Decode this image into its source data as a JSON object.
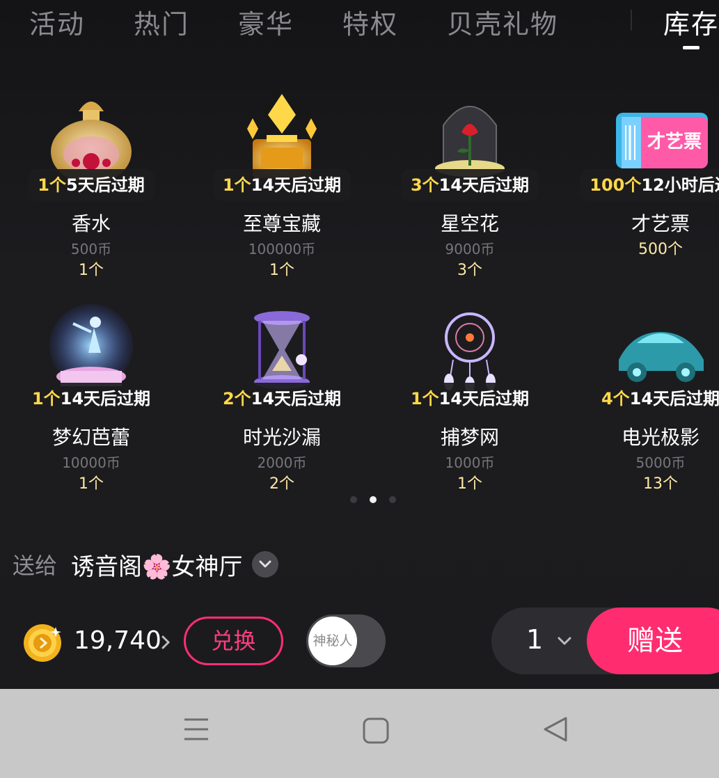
{
  "tabs": [
    {
      "label": "活动"
    },
    {
      "label": "热门"
    },
    {
      "label": "豪华"
    },
    {
      "label": "特权"
    },
    {
      "label": "贝壳礼物"
    },
    {
      "label": "库存",
      "active": true
    }
  ],
  "gifts": [
    {
      "name": "香水",
      "badge_count": "1个",
      "badge_expire": "5天后过期",
      "price": "500币",
      "count": "1个",
      "icon": "perfume-bottle-icon"
    },
    {
      "name": "至尊宝藏",
      "badge_count": "1个",
      "badge_expire": "14天后过期",
      "price": "100000币",
      "count": "1个",
      "icon": "treasure-icon"
    },
    {
      "name": "星空花",
      "badge_count": "3个",
      "badge_expire": "14天后过期",
      "price": "9000币",
      "count": "3个",
      "icon": "rose-dome-icon"
    },
    {
      "name": "才艺票",
      "badge_count": "100个",
      "badge_expire": "12小时后过",
      "price": "",
      "count": "500个",
      "icon": "talent-ticket-icon",
      "ticket_text": "才艺票"
    },
    {
      "name": "梦幻芭蕾",
      "badge_count": "1个",
      "badge_expire": "14天后过期",
      "price": "10000币",
      "count": "1个",
      "icon": "ballet-music-box-icon"
    },
    {
      "name": "时光沙漏",
      "badge_count": "2个",
      "badge_expire": "14天后过期",
      "price": "2000币",
      "count": "2个",
      "icon": "hourglass-icon"
    },
    {
      "name": "捕梦网",
      "badge_count": "1个",
      "badge_expire": "14天后过期",
      "price": "1000币",
      "count": "1个",
      "icon": "dreamcatcher-icon"
    },
    {
      "name": "电光极影",
      "badge_count": "4个",
      "badge_expire": "14天后过期",
      "price": "5000币",
      "count": "13个",
      "icon": "electric-car-icon"
    }
  ],
  "pager": {
    "pages": 3,
    "current": 2
  },
  "send_to": {
    "label": "送给",
    "recipient": "诱音阁🌸女神厅"
  },
  "wallet": {
    "balance": "19,740",
    "exchange_label": "兑换"
  },
  "anonymous": {
    "label": "神秘人",
    "enabled": false
  },
  "quantity": {
    "value": "1"
  },
  "give_button": {
    "label": "赠送"
  },
  "colors": {
    "accent": "#ff2d6f",
    "badge_number": "#ffd84a",
    "count": "#ffe9a6",
    "panel_bg": "#1b1b1e",
    "navbar_bg": "#c8c8c8"
  }
}
